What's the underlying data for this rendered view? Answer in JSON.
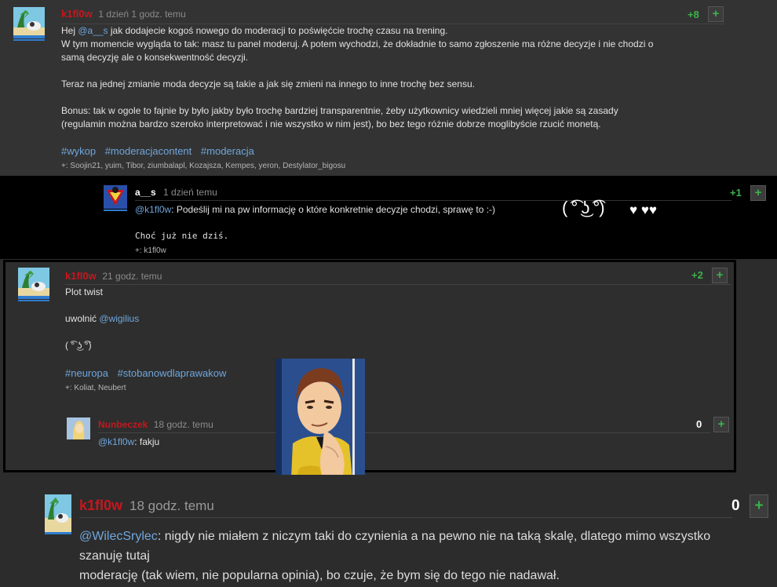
{
  "comment1": {
    "username": "k1fl0w",
    "time": "1 dzień 1 godz. temu",
    "score": "+8",
    "plus_label": "+",
    "line1_pre": "Hej ",
    "line1_mention": "@a__s",
    "line1_post": " jak dodajecie kogoś nowego do moderacji to poświęćcie trochę czasu na trening.",
    "line2": "W tym momencie wygląda to tak: masz tu panel moderuj. A potem wychodzi, że dokładnie to samo zgłoszenie ma różne decyzje i nie chodzi o",
    "line3": "samą decyzję ale o konsekwentność decyzji.",
    "para2": "Teraz na jednej zmianie moda decyzje są takie a jak się zmieni na innego to inne trochę bez sensu.",
    "para3_line1": "Bonus: tak w ogole to fajnie by było jakby było trochę bardziej transparentnie, żeby użytkownicy wiedzieli mniej więcej jakie są zasady",
    "para3_line2": "(regulamin można bardzo szeroko interpretować i nie wszystko w nim jest), bo bez tego różnie dobrze moglibyście rzucić monetą.",
    "tags": [
      "#wykop",
      "#moderacjacontent",
      "#moderacja"
    ],
    "voters_prefix": "+:",
    "voters": "Soojin21, yuim, Tibor, ziumbalapl, Kozajsza, Kempes, yeron, Destylator_bigosu"
  },
  "reply1": {
    "username": "a__s",
    "time": "1 dzień temu",
    "score": "+1",
    "plus_label": "+",
    "mention": "@k1fl0w",
    "text": ": Podeślij mi na pw informację o które konkretnie decyzje chodzi, sprawę to :-)",
    "signature": "Choć już nie dziś.",
    "voters_prefix": "+:",
    "voters": "k1fl0w",
    "lenny": "( ͡° ͜ʖ ͡°)",
    "hearts": "♥ ♥♥"
  },
  "comment2": {
    "username": "k1fl0w",
    "time": "21 godz. temu",
    "score": "+2",
    "plus_label": "+",
    "line1": "Plot twist",
    "line2_pre": "uwolnić ",
    "line2_mention": "@wigilius",
    "lenny": "( ͡° ͜ʖ ͡°)",
    "tags": [
      "#neuropa",
      "#stobanowdlaprawakow"
    ],
    "voters_prefix": "+:",
    "voters": "Koliat, Neubert"
  },
  "reply2": {
    "username": "Nunbeczek",
    "time": "18 godz. temu",
    "score": "0",
    "plus_label": "+",
    "mention": "@k1fl0w",
    "text": ": fakju"
  },
  "comment3": {
    "username": "k1fl0w",
    "time": "18 godz. temu",
    "score": "0",
    "plus_label": "+",
    "mention": "@WilecSrylec",
    "line1": ": nigdy nie miałem z niczym taki do czynienia a na pewno nie na taką skalę, dlatego mimo wszystko szanuję tutaj",
    "line2": "moderację (tak wiem, nie popularna opinia), bo czuje, że bym się do tego nie nadawał."
  },
  "colors": {
    "username_red": "#c8161d",
    "score_green": "#3bb34a",
    "link_blue": "#6fa6dc",
    "background": "#2c2c2c"
  }
}
